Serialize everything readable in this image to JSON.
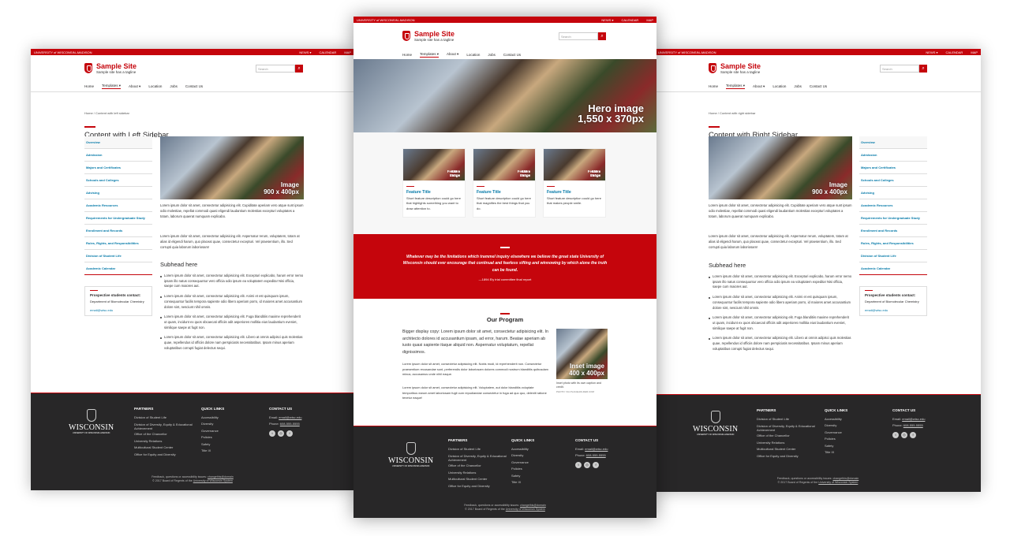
{
  "topbar": {
    "university": "UNIVERSITY of WISCONSIN–MADISON",
    "links": [
      "NEWS ▾",
      "CALENDAR",
      "MAP"
    ]
  },
  "site": {
    "title": "Sample Site",
    "tagline": "Sample site has a tagline"
  },
  "search": {
    "placeholder": "Search"
  },
  "nav": [
    "Home",
    "Templates ▾",
    "About ▾",
    "Location",
    "Jobs",
    "Contact Us"
  ],
  "breadcrumb": {
    "home": "Home",
    "sep": "/",
    "current": "Content with left sidebar",
    "current_right": "Content with right sidebar"
  },
  "left": {
    "title": "Content with Left Sidebar"
  },
  "right": {
    "title": "Content with Right Sidebar"
  },
  "sidebar": [
    "Overview",
    "Admission",
    "Majors and Certificates",
    "Schools and Colleges",
    "Advising",
    "Academic Resources",
    "Requirements for Undergraduate Study",
    "Enrollment and Records",
    "Rules, Rights, and Responsibilities",
    "Division of Student Life",
    "Academic Calendar"
  ],
  "contact_box": {
    "title": "Prospective students contact:",
    "dept": "Department of Biomolecular Chemistry",
    "email": "email@wisc.edu"
  },
  "image": {
    "label1": "Image",
    "label2": "900 x 400px"
  },
  "body": {
    "p1": "Lorem ipsum dolor sit amet, consectetur adipisicing elit. Cupiditate aperiam vero atque sunt ipsum odio molestiae, repellat commodi quasi eligendi laudantium molestias excepturi voluptates a totam, laborum quaerat numquam explicabo.",
    "p2": "Lorem ipsum dolor sit amet, consectetur adipisicing elit. Aspernatur rerum, voluptatem, totam at alias id eligendi harum, quo placeat quae, consectetur excepturi. Vel praesentium, illo. Sed corrupti quia laborum laboriosam!",
    "subhead": "Subhead here",
    "bullets": [
      "Lorem ipsum dolor sit amet, consectetur adipisicing elit. Excepturi explicabo, harum error nemo ipsam illo natus consequuntur vero officia odio ipsum ea voluptatem expedita! Nisi officia, saepe cum maiores aut.",
      "Lorem ipsum dolor sit amet, consectetur adipisicing elit. Animi et est quisquam ipsum, consequuntur facilis tempora sapiente odio libero aperiam porro, id maiores amet accusantium dolore sint, nesciunt nihil omnis.",
      "Lorem ipsum dolor sit amet, consectetur adipisicing elit. Fuga blanditiis maxime reprehenderit ut quam, incidunt ex quos obcaecati officiis odit asperiores mollitia eius laudantium eveniet, similique saepe at fugit non.",
      "Lorem ipsum dolor sit amet, consectetur adipisicing elit. Libero at omnis adipisci quis molestias quae, repellendus id officiis dolore nam perspiciatis necessitatibus. Ipsam minus aperiam voluptatibus corrupti fugiat delectus sequi."
    ]
  },
  "hero": {
    "label1": "Hero image",
    "label2": "1,550 x 370px"
  },
  "features": [
    {
      "img": "Feature Image",
      "size": "630 x 210px",
      "title": "Feature Title",
      "desc": "Short feature description could go here that highlights something you want to draw attention to."
    },
    {
      "img": "Feature Image",
      "size": "630 x 210px",
      "title": "Feature Title",
      "desc": "Short feature description could go here that magnifies the best things that you do."
    },
    {
      "img": "Feature Image",
      "size": "630 x 210px",
      "title": "Feature Title",
      "desc": "Short feature description could go here that makes people smile."
    }
  ],
  "quote": {
    "text": "Whatever may be the limitations which trammel inquiry elsewhere we believe the great state University of Wisconsin should ever encourage that continual and fearless sifting and winnowing by which alone the truth can be found.",
    "cite": "—1894 Ely trial committee final report"
  },
  "program": {
    "title": "Our Program",
    "lead": "Bigger display copy: Lorem ipsum dolor sit amet, consectetur adipisicing elit. In architecto dolores id accusantium ipsam, ad error, harum. Beatae aperiam ab iusto quasi sapiente itaque aliquid non. Aspernatur voluptatum, repellat dignissimos.",
    "p1": "Lorem ipsum dolor sit amet, consectetur adipisicing elit. Nobis modi, id reprehenderit non. Consectetur praesentium recusandae sunt, perferendis dolor laboriosam dolores commodi nostrum blanditiis quibusdam minus; accusamus unde nihil eaque.",
    "p2": "Lorem ipsum dolor sit amet, consectetur adipisicing elit. Voluptatem, aut dolor blanditiis voluptate temporibus earum amet laboriosam fugit cum repudiandae consectetur in fuga ad quo quo, deleniti ratione tenetur eaque!",
    "inset1": "Inset image",
    "inset2": "400 x 400px",
    "inset_caption": "Inset photo with its own caption and credit.",
    "inset_credit": "PHOTO: VIA PLACEHOLDER.COM"
  },
  "footer": {
    "wordmark": "WISCONSIN",
    "wordmark_sub": "UNIVERSITY OF WISCONSIN–MADISON",
    "partners_h": "PARTNERS",
    "partners": [
      "Division of Student Life",
      "Division of Diversity, Equity & Educational Achievement",
      "Office of the Chancellor",
      "University Relations",
      "Multicultural Student Center",
      "Office for Equity and Diversity"
    ],
    "quick_h": "QUICK LINKS",
    "quick": [
      "Accessibility",
      "Diversity",
      "Governance",
      "Policies",
      "Safety",
      "Title IX"
    ],
    "contact_h": "CONTACT US",
    "email_label": "Email: ",
    "email": "email@wisc.edu",
    "phone_label": "Phone: ",
    "phone": "608-555-5555",
    "feedback": "Feedback, questions or accessibility issues: ",
    "feedback_link": "changethis@domain",
    "copyright": "© 2017 Board of Regents of the ",
    "copyright_link": "University of Wisconsin System"
  },
  "colors": {
    "red": "#c5050c",
    "link": "#0479a8",
    "footer": "#282728"
  }
}
